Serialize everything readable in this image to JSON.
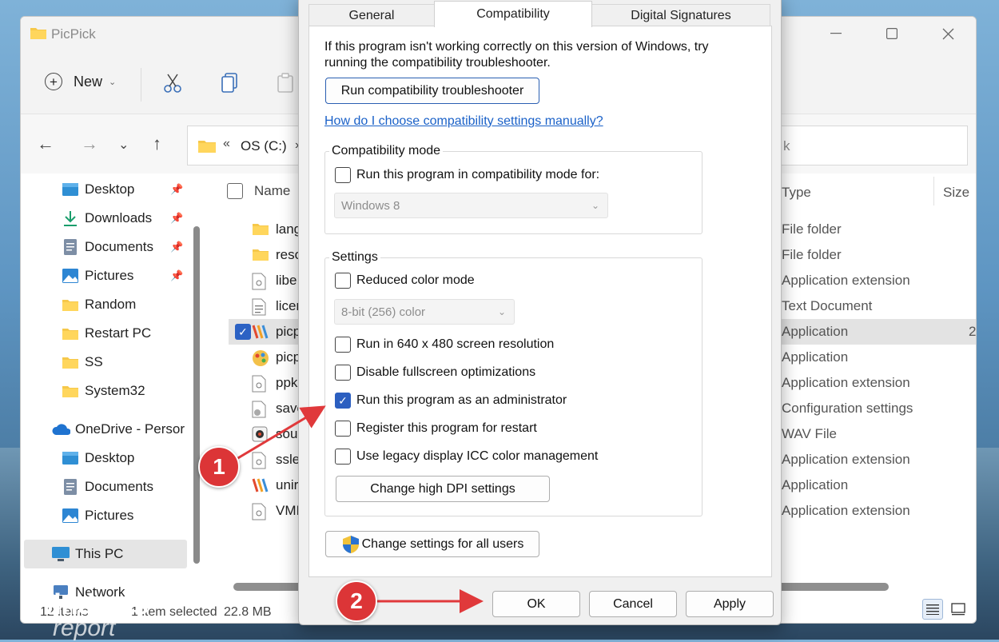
{
  "explorer": {
    "title": "PicPick",
    "toolbar": {
      "new_label": "New"
    },
    "address": {
      "root_glyph": "«",
      "path": "OS (C:)",
      "separator": "›"
    },
    "search": {
      "visible_text": "k"
    },
    "sidebar": {
      "items": [
        {
          "label": "Desktop",
          "icon": "desktop-icon",
          "pinned": true
        },
        {
          "label": "Downloads",
          "icon": "download-icon",
          "pinned": true
        },
        {
          "label": "Documents",
          "icon": "documents-icon",
          "pinned": true
        },
        {
          "label": "Pictures",
          "icon": "pictures-icon",
          "pinned": true
        },
        {
          "label": "Random",
          "icon": "folder-icon",
          "pinned": false
        },
        {
          "label": "Restart PC",
          "icon": "folder-icon",
          "pinned": false
        },
        {
          "label": "SS",
          "icon": "folder-icon",
          "pinned": false
        },
        {
          "label": "System32",
          "icon": "folder-icon",
          "pinned": false
        }
      ],
      "onedrive": "OneDrive - Persor",
      "onedrive_items": [
        {
          "label": "Desktop",
          "icon": "desktop-icon"
        },
        {
          "label": "Documents",
          "icon": "documents-icon"
        },
        {
          "label": "Pictures",
          "icon": "pictures-icon"
        }
      ],
      "this_pc": "This PC",
      "network": "Network"
    },
    "columns": {
      "name": "Name",
      "type": "Type",
      "size": "Size"
    },
    "files": [
      {
        "name": "lang",
        "type": "File folder",
        "icon": "folder-icon"
      },
      {
        "name": "reso",
        "type": "File folder",
        "icon": "folder-icon"
      },
      {
        "name": "libe",
        "type": "Application extension",
        "icon": "dll-icon"
      },
      {
        "name": "licen",
        "type": "Text Document",
        "icon": "text-file-icon"
      },
      {
        "name": "picp",
        "type": "Application",
        "icon": "picpick-app-icon",
        "selected": true,
        "size": "2"
      },
      {
        "name": "picp",
        "type": "Application",
        "icon": "palette-app-icon"
      },
      {
        "name": "ppk",
        "type": "Application extension",
        "icon": "dll-icon"
      },
      {
        "name": "save",
        "type": "Configuration settings",
        "icon": "config-icon"
      },
      {
        "name": "sou",
        "type": "WAV File",
        "icon": "audio-file-icon"
      },
      {
        "name": "ssle",
        "type": "Application extension",
        "icon": "dll-icon"
      },
      {
        "name": "unir",
        "type": "Application",
        "icon": "picpick-app-icon"
      },
      {
        "name": "VMI",
        "type": "Application extension",
        "icon": "dll-icon"
      }
    ],
    "status": {
      "count": "12 items",
      "selected": "1 item selected",
      "size": "22.8 MB"
    }
  },
  "dialog": {
    "tabs": [
      "General",
      "Compatibility",
      "Digital Signatures"
    ],
    "active_tab": 1,
    "intro": "If this program isn't working correctly on this version of Windows, try running the compatibility troubleshooter.",
    "troubleshooter_button": "Run compatibility troubleshooter",
    "help_link": "How do I choose compatibility settings manually?",
    "compat_mode": {
      "label": "Compatibility mode",
      "checkbox": "Run this program in compatibility mode for:",
      "checked": false,
      "select_value": "Windows 8"
    },
    "settings": {
      "label": "Settings",
      "reduced_color": "Reduced color mode",
      "color_select": "8-bit (256) color",
      "res_640": "Run in 640 x 480 screen resolution",
      "disable_fullscreen": "Disable fullscreen optimizations",
      "run_admin": "Run this program as an administrator",
      "register_restart": "Register this program for restart",
      "legacy_icc": "Use legacy display ICC color management",
      "high_dpi_button": "Change high DPI settings"
    },
    "all_users_button": "Change settings for all users",
    "ok": "OK",
    "cancel": "Cancel",
    "apply": "Apply"
  },
  "annotations": {
    "step1": "1",
    "step2": "2",
    "arrow_color": "#e0393b"
  },
  "watermark": {
    "line1": "windows",
    "line2": "report"
  }
}
